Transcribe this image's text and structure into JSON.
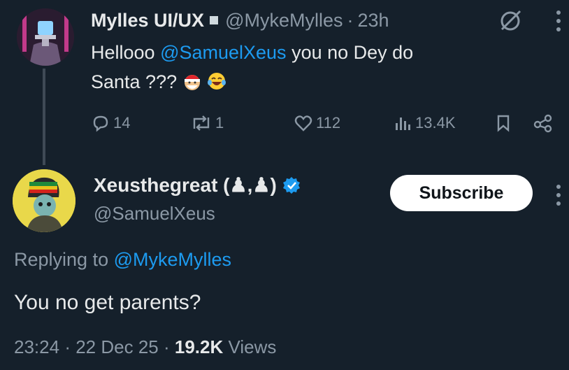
{
  "original_tweet": {
    "author_name": "Mylles UI/UX",
    "handle": "@MykeMylles",
    "separator": "·",
    "time": "23h",
    "text_before": "Hellooo ",
    "mention": "@SamuelXeus",
    "text_after_line1": " you no Dey do",
    "text_line2": "Santa ???",
    "emoji_icons": [
      "santa-face-emoji-icon",
      "laughing-tears-emoji-icon"
    ],
    "stats": {
      "replies": "14",
      "reposts": "1",
      "likes": "112",
      "views": "13.4K"
    }
  },
  "reply_tweet": {
    "author_name": "Xeusthegreat (♟,♟)",
    "handle": "@SamuelXeus",
    "subscribe_label": "Subscribe",
    "replying_label": "Replying to ",
    "replying_to": "@MykeMylles",
    "text": "You no get parents?",
    "time": "23:24",
    "date": "22 Dec 25",
    "views_count": "19.2K",
    "views_label": "Views",
    "separator": "·"
  },
  "colors": {
    "background": "#15202b",
    "accent": "#1d9bf0",
    "text_primary": "#e7e9ea",
    "text_secondary": "#8b98a5"
  }
}
